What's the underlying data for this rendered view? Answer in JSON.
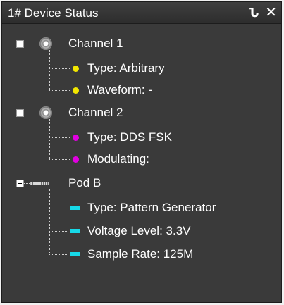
{
  "panel": {
    "title": "1# Device Status",
    "pin_glyph": "Ն",
    "close_glyph": "✕"
  },
  "colors": {
    "panel_bg": "#3a3a3a",
    "text": "#ffffff",
    "channel1_indicator": "#f2e600",
    "channel2_indicator": "#e100e1",
    "podb_indicator": "#17d9e8"
  },
  "tree": {
    "channel1": {
      "label": "Channel 1",
      "icon": "bnc-connector-icon",
      "expanded": true,
      "items": [
        {
          "label": "Type: Arbitrary"
        },
        {
          "label": "Waveform: -"
        }
      ]
    },
    "channel2": {
      "label": "Channel 2",
      "icon": "bnc-connector-icon",
      "expanded": true,
      "items": [
        {
          "label": "Type: DDS FSK"
        },
        {
          "label": "Modulating:"
        }
      ]
    },
    "podb": {
      "label": "Pod B",
      "icon": "pod-connector-icon",
      "expanded": true,
      "items": [
        {
          "label": "Type: Pattern Generator"
        },
        {
          "label": "Voltage Level: 3.3V"
        },
        {
          "label": "Sample Rate: 125M"
        }
      ]
    }
  }
}
